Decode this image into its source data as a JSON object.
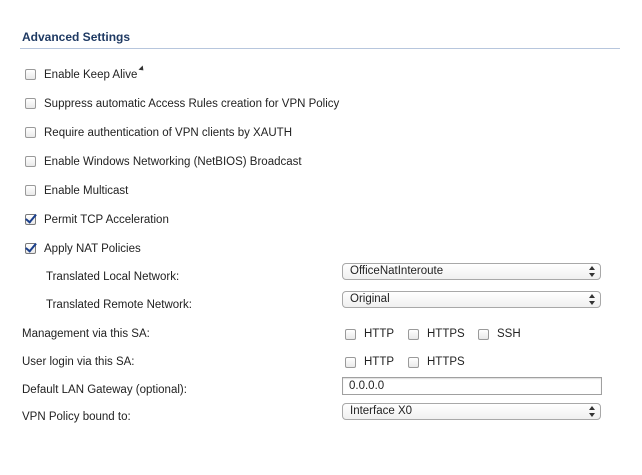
{
  "section": {
    "title": "Advanced Settings"
  },
  "checkboxes": [
    {
      "label": "Enable Keep Alive",
      "checked": false
    },
    {
      "label": "Suppress automatic Access Rules creation for VPN Policy",
      "checked": false
    },
    {
      "label": "Require authentication of VPN clients by XAUTH",
      "checked": false
    },
    {
      "label": "Enable Windows Networking (NetBIOS) Broadcast",
      "checked": false
    },
    {
      "label": "Enable Multicast",
      "checked": false
    },
    {
      "label": "Permit TCP Acceleration",
      "checked": true
    },
    {
      "label": "Apply NAT Policies",
      "checked": true
    }
  ],
  "nat": {
    "local_label": "Translated Local Network:",
    "local_value": "OfficeNatInteroute",
    "remote_label": "Translated Remote Network:",
    "remote_value": "Original"
  },
  "management": {
    "label": "Management via this SA:",
    "options": [
      {
        "label": "HTTP",
        "checked": false
      },
      {
        "label": "HTTPS",
        "checked": false
      },
      {
        "label": "SSH",
        "checked": false
      }
    ]
  },
  "user_login": {
    "label": "User login via this SA:",
    "options": [
      {
        "label": "HTTP",
        "checked": false
      },
      {
        "label": "HTTPS",
        "checked": false
      }
    ]
  },
  "gateway": {
    "label": "Default LAN Gateway (optional):",
    "value": "0.0.0.0"
  },
  "policy_bound": {
    "label": "VPN Policy bound to:",
    "value": "Interface X0"
  },
  "colors": {
    "heading": "#1f3a63",
    "rule": "#b7c6dd",
    "check": "#1a3f8c"
  }
}
